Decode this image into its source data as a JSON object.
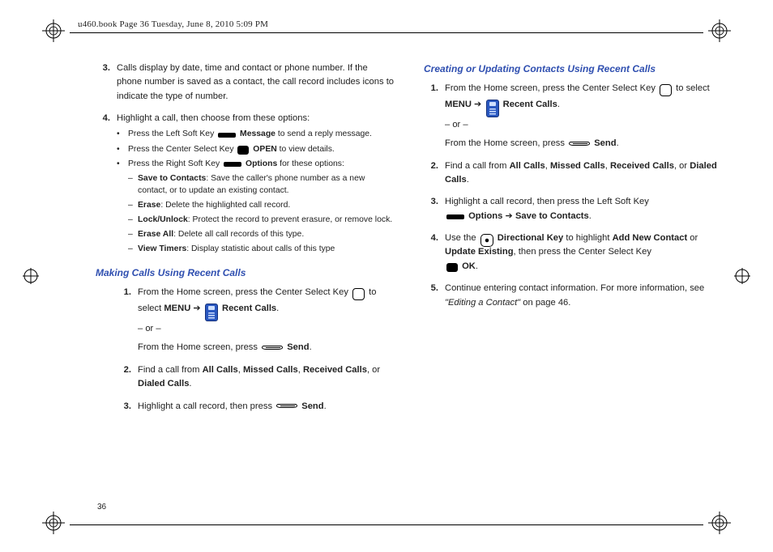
{
  "header": {
    "label": "u460.book  Page 36  Tuesday, June 8, 2010  5:09 PM"
  },
  "page_number": "36",
  "left": {
    "items": {
      "i3": {
        "num": "3.",
        "text": "Calls display by date, time and contact or phone number. If the phone number is saved as a contact, the call record includes icons to indicate the type of number."
      },
      "i4": {
        "num": "4.",
        "text": "Highlight a call, then choose from these options:",
        "sub": {
          "b1a": "Press the Left Soft Key ",
          "b1b": " Message",
          "b1c": " to send a reply message.",
          "b2a": "Press the Center Select Key ",
          "b2b": " OPEN",
          "b2c": " to view details.",
          "b3a": "Press the Right Soft Key ",
          "b3b": " Options",
          "b3c": " for these options:",
          "d1a": "Save to Contacts",
          "d1b": ": Save the caller's phone number as a new contact, or to update an existing contact.",
          "d2a": "Erase",
          "d2b": ": Delete the highlighted call record.",
          "d3a": "Lock/Unlock",
          "d3b": ": Protect the record to prevent erasure, or remove lock.",
          "d4a": "Erase All",
          "d4b": ": Delete all call records of this type.",
          "d5a": "View Timers",
          "d5b": ": Display statistic about calls of this type"
        }
      }
    },
    "section_title": "Making Calls Using Recent Calls",
    "sec": {
      "s1": {
        "num": "1.",
        "a": "From the Home screen, press the Center Select Key ",
        "b": "to select ",
        "menu": "MENU",
        "arrow": " ➔ ",
        "rc": " Recent Calls",
        "or": "– or –",
        "c": "From the Home screen, press ",
        "send": " Send"
      },
      "s2": {
        "num": "2.",
        "a": "Find a call from ",
        "ac": "All Calls",
        "sep1": ", ",
        "mc": "Missed Calls",
        "sep2": ", ",
        "rc": "Received Calls",
        "sep3": ", or ",
        "dc": "Dialed Calls",
        "end": "."
      },
      "s3": {
        "num": "3.",
        "a": "Highlight a call record, then press ",
        "send": " Send",
        "end": "."
      }
    }
  },
  "right": {
    "section_title": "Creating or Updating Contacts Using Recent Calls",
    "sec": {
      "s1": {
        "num": "1.",
        "a": "From the Home screen, press the Center Select Key ",
        "b": "to select  ",
        "menu": "MENU",
        "arrow": " ➔ ",
        "rc": " Recent Calls",
        "or": "– or –",
        "c": "From the Home screen, press ",
        "send": " Send",
        "end": "."
      },
      "s2": {
        "num": "2.",
        "a": "Find a call from ",
        "ac": "All Calls",
        "sep1": ", ",
        "mc": "Missed Calls",
        "sep2": ", ",
        "rc": "Received Calls",
        "sep3": ", or ",
        "dc": "Dialed Calls",
        "end": "."
      },
      "s3": {
        "num": "3.",
        "a": "Highlight a call record, then press the Left Soft Key ",
        "opt": " Options ",
        "arrow": " ➔ ",
        "stc": "Save to Contacts",
        "end": "."
      },
      "s4": {
        "num": "4.",
        "a": "Use the ",
        "dk": " Directional Key",
        "b": " to highlight ",
        "anc": "Add New Contact",
        "c": " or ",
        "ue": "Update Existing",
        "d": ", then press the Center Select Key ",
        "ok": " OK",
        "end": "."
      },
      "s5": {
        "num": "5.",
        "a": "Continue entering contact information. For more information, see ",
        "ref": "\"Editing a Contact\"",
        "b": " on page 46."
      }
    }
  }
}
